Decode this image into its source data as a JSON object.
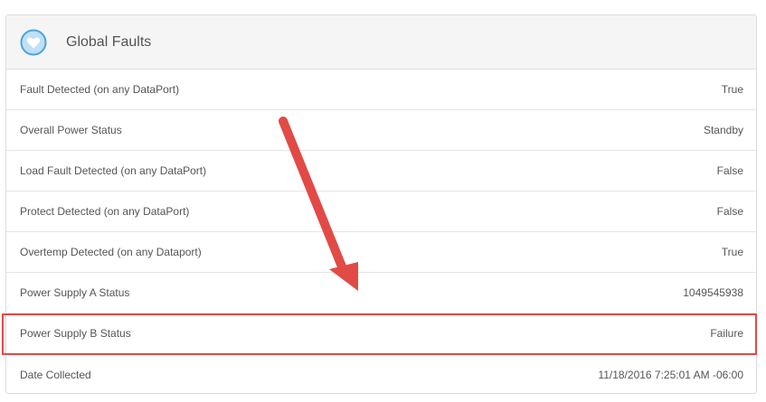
{
  "panel": {
    "title": "Global Faults",
    "icon": "heart-icon",
    "rows": [
      {
        "label": "Fault Detected (on any DataPort)",
        "value": "True"
      },
      {
        "label": "Overall Power Status",
        "value": "Standby"
      },
      {
        "label": "Load Fault Detected (on any DataPort)",
        "value": "False"
      },
      {
        "label": "Protect Detected (on any DataPort)",
        "value": "False"
      },
      {
        "label": "Overtemp Detected (on any Dataport)",
        "value": "True"
      },
      {
        "label": "Power Supply A Status",
        "value": "1049545938"
      },
      {
        "label": "Power Supply B Status",
        "value": "Failure"
      },
      {
        "label": "Date Collected",
        "value": "11/18/2016 7:25:01 AM -06:00"
      }
    ]
  },
  "annotation": {
    "highlight_color": "#e24a45",
    "arrow_color": "#e24a45"
  }
}
